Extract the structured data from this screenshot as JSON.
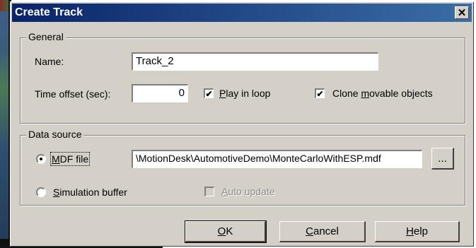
{
  "dialog": {
    "title": "Create Track",
    "close_icon": "close-icon",
    "close_glyph": "✕"
  },
  "general": {
    "legend": "General",
    "name_label": "Name:",
    "name_value": "Track_2",
    "time_offset_label": "Time offset (sec):",
    "time_offset_value": "0",
    "play_in_loop": {
      "label_pre": "",
      "label_u": "P",
      "label_post": "lay in loop",
      "checked": true
    },
    "clone_movable": {
      "label_pre": "Clone ",
      "label_u": "m",
      "label_post": "ovable objects",
      "checked": true
    }
  },
  "data_source": {
    "legend": "Data source",
    "mdf_radio": {
      "label_pre": "",
      "label_u": "M",
      "label_post": "DF file",
      "selected": true
    },
    "mdf_path": "\\MotionDesk\\AutomotiveDemo\\MonteCarloWithESP.mdf",
    "browse_label": "...",
    "sim_radio": {
      "label_pre": "",
      "label_u": "S",
      "label_post": "imulation buffer",
      "selected": false
    },
    "auto_update": {
      "label_pre": "",
      "label_u": "A",
      "label_post": "uto update",
      "checked": false,
      "disabled": true
    }
  },
  "buttons": {
    "ok": {
      "u": "O",
      "rest": "K"
    },
    "cancel": {
      "u": "C",
      "rest": "ancel"
    },
    "help": {
      "u": "H",
      "rest": "elp"
    }
  },
  "check_glyph": "✔"
}
